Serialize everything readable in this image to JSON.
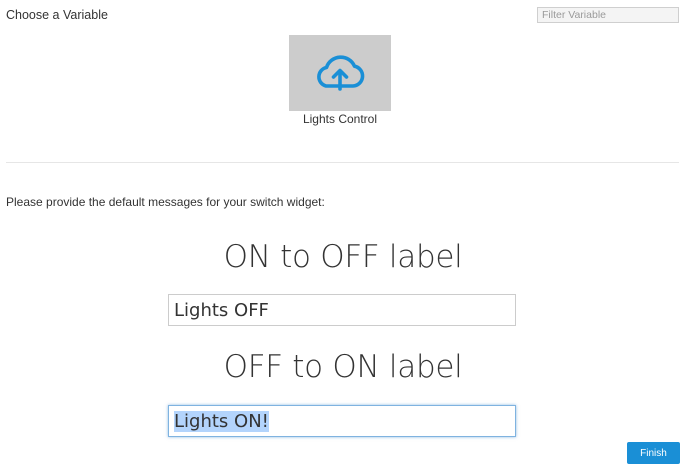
{
  "header": {
    "title": "Choose a Variable",
    "filter_placeholder": "Filter Variable",
    "filter_value": ""
  },
  "variables": [
    {
      "label": "Lights Control",
      "icon": "cloud-upload-icon",
      "icon_color": "#1a8fd6",
      "tile_color": "#cccccc"
    }
  ],
  "form": {
    "instructions": "Please provide the default messages for your switch widget:",
    "on_to_off_label": "ON to OFF label",
    "on_to_off_value": "Lights OFF",
    "off_to_on_label": "OFF to ON label",
    "off_to_on_value": "Lights ON!"
  },
  "actions": {
    "finish_label": "Finish",
    "accent": "#1a8fd6"
  }
}
